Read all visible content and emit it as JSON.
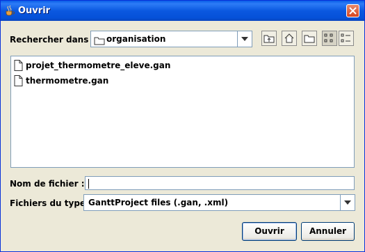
{
  "window": {
    "title": "Ouvrir"
  },
  "lookin": {
    "label": "Rechercher dans :",
    "folder": "organisation"
  },
  "files": [
    {
      "name": "projet_thermometre_eleve.gan"
    },
    {
      "name": "thermometre.gan"
    }
  ],
  "filename": {
    "label": "Nom de fichier :",
    "value": ""
  },
  "filetype": {
    "label": "Fichiers du type :",
    "value": "GanttProject files (.gan, .xml)"
  },
  "buttons": {
    "open": "Ouvrir",
    "cancel": "Annuler"
  },
  "colors": {
    "title_bar": "#0a5ee8",
    "close": "#d8451f",
    "dialog_bg": "#ece9d8"
  }
}
